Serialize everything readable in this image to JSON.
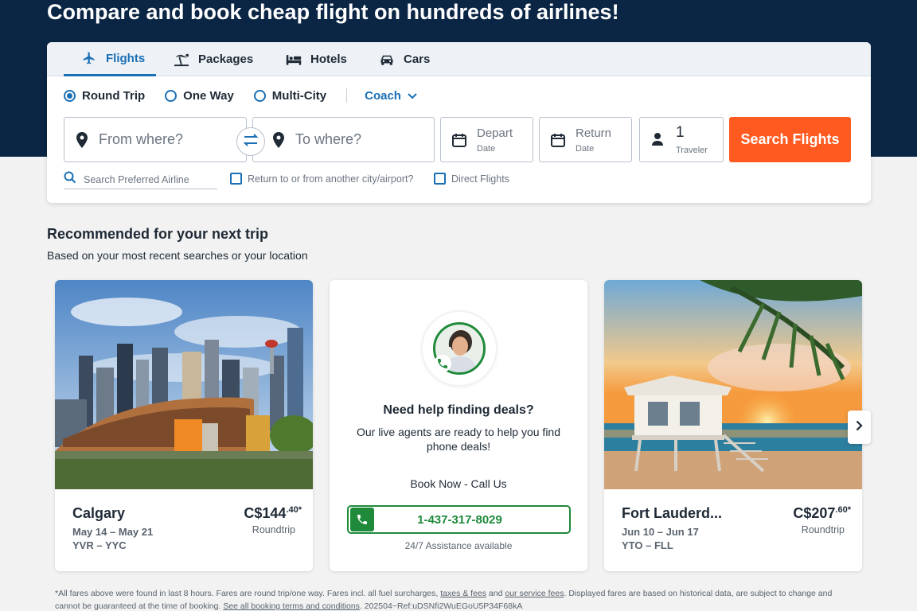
{
  "hero": {
    "title": "Compare and book cheap flight on hundreds of airlines!"
  },
  "tabs": [
    {
      "label": "Flights",
      "icon": "plane-icon"
    },
    {
      "label": "Packages",
      "icon": "beach-icon"
    },
    {
      "label": "Hotels",
      "icon": "bed-icon"
    },
    {
      "label": "Cars",
      "icon": "car-icon"
    }
  ],
  "trip_types": [
    {
      "label": "Round Trip",
      "selected": true
    },
    {
      "label": "One Way",
      "selected": false
    },
    {
      "label": "Multi-City",
      "selected": false
    }
  ],
  "cabin": {
    "label": "Coach"
  },
  "form": {
    "from_placeholder": "From where?",
    "to_placeholder": "To where?",
    "depart_label": "Depart",
    "depart_sub": "Date",
    "return_label": "Return",
    "return_sub": "Date",
    "travelers_count": "1",
    "travelers_label": "Traveler",
    "search_label": "Search Flights",
    "airline_placeholder": "Search Preferred Airline",
    "return_other_label": "Return to or from another city/airport?",
    "direct_label": "Direct Flights"
  },
  "recommended": {
    "title": "Recommended for your next trip",
    "subtitle": "Based on your most recent searches or your location"
  },
  "deals": [
    {
      "city": "Calgary",
      "dates": "May 14 – May 21",
      "route": "YVR – YYC",
      "price_main": "C$144",
      "price_cents": ".40*",
      "trip": "Roundtrip"
    },
    {
      "city": "Fort Lauderd...",
      "dates": "Jun 10 – Jun 17",
      "route": "YTO – FLL",
      "price_main": "C$207",
      "price_cents": ".60*",
      "trip": "Roundtrip"
    }
  ],
  "agent": {
    "title": "Need help finding deals?",
    "text": "Our live agents are ready to help you find phone deals!",
    "book_now": "Book Now - Call Us",
    "phone": "1-437-317-8029",
    "assist": "24/7 Assistance available"
  },
  "disclaimer": {
    "part1": "*All fares above were found in last 8 hours. Fares are round trip/one way. Fares incl. all fuel surcharges,",
    "link1": "taxes & fees",
    "part2": "and",
    "link2": "our service fees",
    "part3": ". Displayed fares are based on historical data, are subject to change and cannot be guaranteed at the time of booking.",
    "link3": "See all booking terms and conditions",
    "part4": ". 202504~Ref:uDSNfi2WuEGoU5P34F68kA"
  },
  "colors": {
    "hero_bg": "#0b2545",
    "accent": "#1a6fb5",
    "cta": "#ff5a1f",
    "phone_green": "#1e8a3a"
  }
}
